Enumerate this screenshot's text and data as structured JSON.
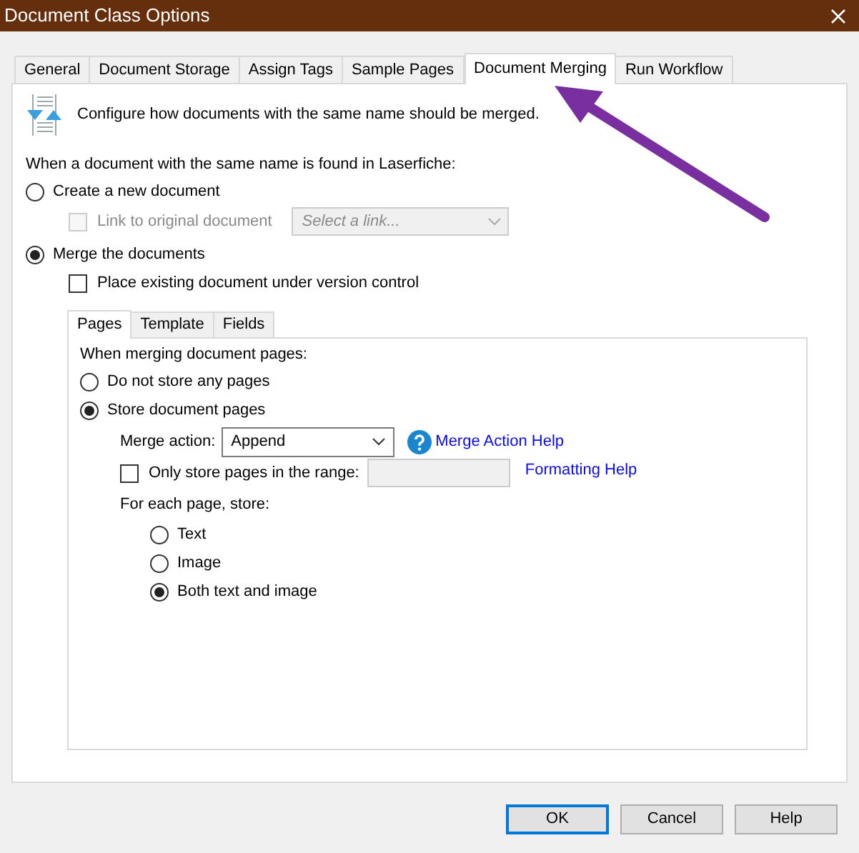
{
  "window": {
    "title": "Document Class Options"
  },
  "tabs": [
    {
      "label": "General",
      "selected": false
    },
    {
      "label": "Document Storage",
      "selected": false
    },
    {
      "label": "Assign Tags",
      "selected": false
    },
    {
      "label": "Sample Pages",
      "selected": false
    },
    {
      "label": "Document Merging",
      "selected": true
    },
    {
      "label": "Run Workflow",
      "selected": false
    }
  ],
  "description": "Configure how documents with the same name should be merged.",
  "section_label": "When a document with the same name is found in Laserfiche:",
  "create_new": {
    "label": "Create a new document",
    "selected": false
  },
  "link_checkbox": {
    "label": "Link to original document",
    "checked": false,
    "disabled": true
  },
  "link_select": {
    "placeholder": "Select a link...",
    "disabled": true
  },
  "merge": {
    "label": "Merge the documents",
    "selected": true
  },
  "version_checkbox": {
    "label": "Place existing document under version control",
    "checked": false
  },
  "inner_tabs": [
    {
      "label": "Pages",
      "selected": true
    },
    {
      "label": "Template",
      "selected": false
    },
    {
      "label": "Fields",
      "selected": false
    }
  ],
  "pages": {
    "heading": "When merging document pages:",
    "store_options": [
      {
        "label": "Do not store any pages",
        "selected": false
      },
      {
        "label": "Store document pages",
        "selected": true
      }
    ],
    "merge_action": {
      "label": "Merge action:",
      "value": "Append",
      "help_link": "Merge Action Help"
    },
    "range": {
      "label": "Only store pages in the range:",
      "checked": false,
      "help_link": "Formatting Help"
    },
    "store_label": "For each page, store:",
    "store_kinds": [
      {
        "label": "Text",
        "selected": false
      },
      {
        "label": "Image",
        "selected": false
      },
      {
        "label": "Both text and image",
        "selected": true
      }
    ]
  },
  "buttons": [
    {
      "label": "OK",
      "default": true
    },
    {
      "label": "Cancel",
      "default": false
    },
    {
      "label": "Help",
      "default": false
    }
  ]
}
